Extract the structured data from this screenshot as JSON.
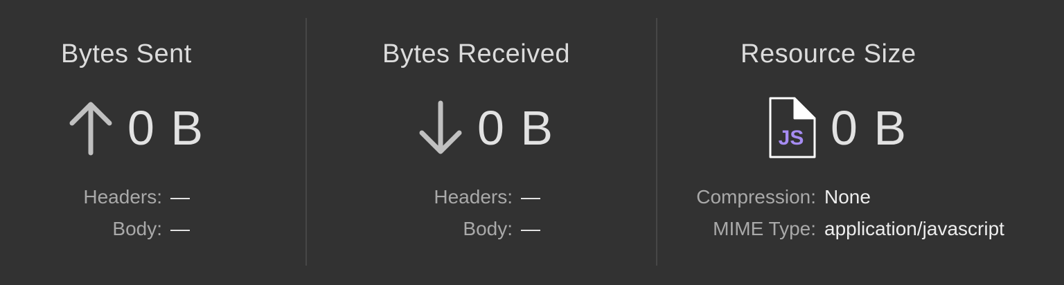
{
  "sent": {
    "title": "Bytes Sent",
    "value": "0 B",
    "icon": "arrow-up-icon",
    "headers_label": "Headers:",
    "headers_value": "—",
    "body_label": "Body:",
    "body_value": "—"
  },
  "received": {
    "title": "Bytes Received",
    "value": "0 B",
    "icon": "arrow-down-icon",
    "headers_label": "Headers:",
    "headers_value": "—",
    "body_label": "Body:",
    "body_value": "—"
  },
  "resource": {
    "title": "Resource Size",
    "value": "0 B",
    "icon": "js-file-icon",
    "icon_text": "JS",
    "compression_label": "Compression:",
    "compression_value": "None",
    "mime_label": "MIME Type:",
    "mime_value": "application/javascript"
  },
  "colors": {
    "background": "#323232",
    "divider": "#474747",
    "title": "#dcdcdc",
    "label": "#a9a9a9",
    "value": "#ededed",
    "arrow": "#c0c0c0",
    "js_accent": "#a68cf2"
  }
}
